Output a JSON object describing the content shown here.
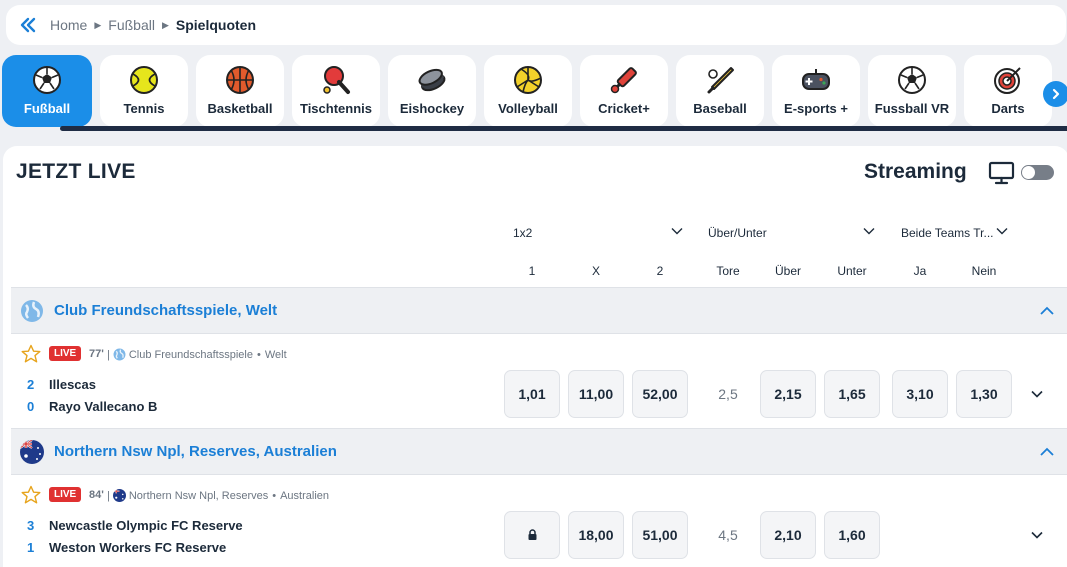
{
  "breadcrumb": {
    "home": "Home",
    "sport": "Fußball",
    "current": "Spielquoten"
  },
  "sports": [
    {
      "label": "Fußball",
      "icon": "soccer-ball-icon",
      "active": true
    },
    {
      "label": "Tennis",
      "icon": "tennis-ball-icon"
    },
    {
      "label": "Basketball",
      "icon": "basketball-icon"
    },
    {
      "label": "Tischtennis",
      "icon": "ping-pong-paddle-icon"
    },
    {
      "label": "Eishockey",
      "icon": "hockey-puck-icon"
    },
    {
      "label": "Volleyball",
      "icon": "volleyball-icon"
    },
    {
      "label": "Cricket+",
      "icon": "cricket-bat-icon"
    },
    {
      "label": "Baseball",
      "icon": "baseball-bat-icon"
    },
    {
      "label": "E-sports +",
      "icon": "gamepad-icon"
    },
    {
      "label": "Fussball VR",
      "icon": "soccer-ball-icon"
    },
    {
      "label": "Darts",
      "icon": "dartboard-icon"
    }
  ],
  "live": {
    "title": "JETZT LIVE",
    "streaming_label": "Streaming",
    "streaming_on": false
  },
  "markets": {
    "m1": "1x2",
    "m2": "Über/Unter",
    "m3": "Beide Teams Tr..."
  },
  "columns": {
    "c1": "1",
    "cx": "X",
    "c2": "2",
    "tore": "Tore",
    "ueber": "Über",
    "unter": "Unter",
    "ja": "Ja",
    "nein": "Nein"
  },
  "leagues": [
    {
      "name": "Club Freundschaftsspiele, Welt",
      "event": {
        "status": "LIVE",
        "minute": "77'",
        "competition": "Club Freundschaftsspiele",
        "region": "Welt",
        "home": {
          "score": "2",
          "name": "Illescas"
        },
        "away": {
          "score": "0",
          "name": "Rayo Vallecano B"
        },
        "odds": {
          "o1": "1,01",
          "ox": "11,00",
          "o2": "52,00",
          "tore": "2,5",
          "ueber": "2,15",
          "unter": "1,65",
          "ja": "3,10",
          "nein": "1,30"
        }
      }
    },
    {
      "name": "Northern Nsw Npl, Reserves, Australien",
      "event": {
        "status": "LIVE",
        "minute": "84'",
        "competition": "Northern Nsw Npl, Reserves",
        "region": "Australien",
        "home": {
          "score": "3",
          "name": "Newcastle Olympic FC Reserve"
        },
        "away": {
          "score": "1",
          "name": "Weston Workers FC Reserve"
        },
        "odds": {
          "o1_locked": true,
          "ox": "18,00",
          "o2": "51,00",
          "tore": "4,5",
          "ueber": "2,10",
          "unter": "1,60"
        }
      }
    }
  ],
  "colors": {
    "accent": "#1b8ee8",
    "live_red": "#e03131",
    "navy": "#1f2c44"
  }
}
